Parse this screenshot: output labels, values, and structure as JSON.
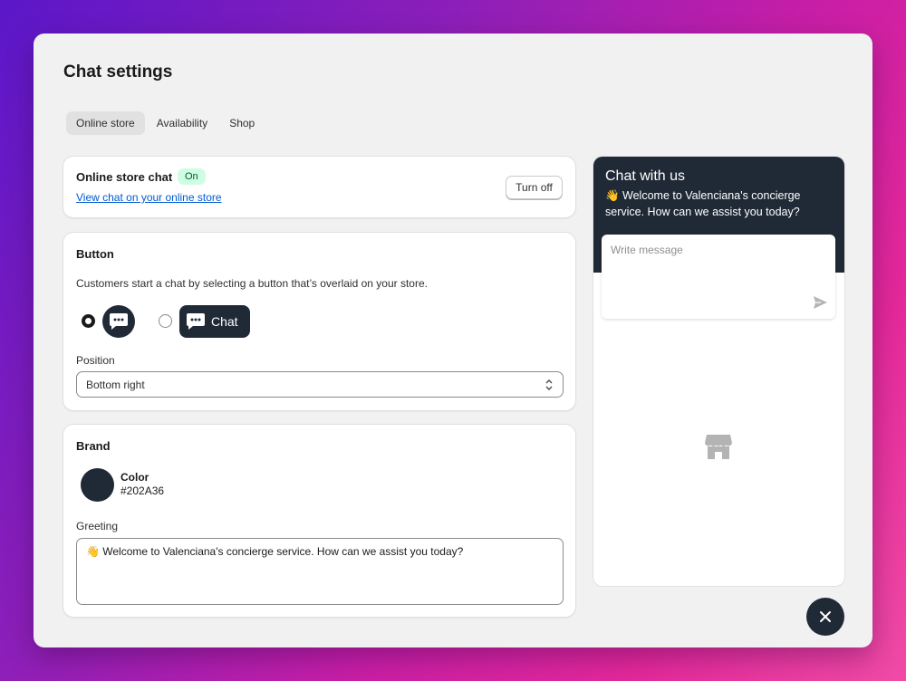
{
  "app": {
    "title": "Chat settings"
  },
  "tabs": [
    {
      "label": "Online store",
      "active": true
    },
    {
      "label": "Availability",
      "active": false
    },
    {
      "label": "Shop",
      "active": false
    }
  ],
  "status": {
    "title": "Online store chat",
    "badge": "On",
    "link": "View chat on your online store",
    "turn_off": "Turn off"
  },
  "button_section": {
    "heading": "Button",
    "description": "Customers start a chat by selecting a button that’s overlaid on your store.",
    "options": [
      {
        "style": "icon-only",
        "selected": true,
        "icon": "chat-bubble-icon"
      },
      {
        "style": "icon-and-text",
        "selected": false,
        "icon": "chat-bubble-icon",
        "label": "Chat"
      }
    ],
    "position_label": "Position",
    "position_value": "Bottom right"
  },
  "brand": {
    "heading": "Brand",
    "color_label": "Color",
    "color_value": "#202A36",
    "greeting_label": "Greeting",
    "greeting_value": "👋 Welcome to Valenciana's concierge service. How can we assist you today?"
  },
  "preview": {
    "title": "Chat with us",
    "greeting": "👋 Welcome to Valenciana's concierge service. How can we assist you today?",
    "message_placeholder": "Write message"
  },
  "colors": {
    "brand": "#202A36",
    "badge_bg": "#cdfee1",
    "link": "#005bd3"
  }
}
